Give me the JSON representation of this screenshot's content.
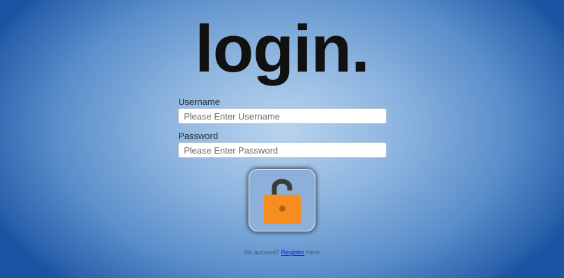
{
  "page": {
    "title": "login."
  },
  "form": {
    "username": {
      "label": "Username",
      "placeholder": "Please Enter Username",
      "value": ""
    },
    "password": {
      "label": "Password",
      "placeholder": "Please Enter Password",
      "value": ""
    },
    "submit_icon": "unlock-icon"
  },
  "footer": {
    "prefix": "No account?",
    "link_label": "Register",
    "suffix": "Here"
  },
  "colors": {
    "lock_body": "#f78d1e",
    "lock_shackle": "#3a3a3a",
    "background_center": "#b8d4ef",
    "background_edge": "#1b54a3"
  }
}
